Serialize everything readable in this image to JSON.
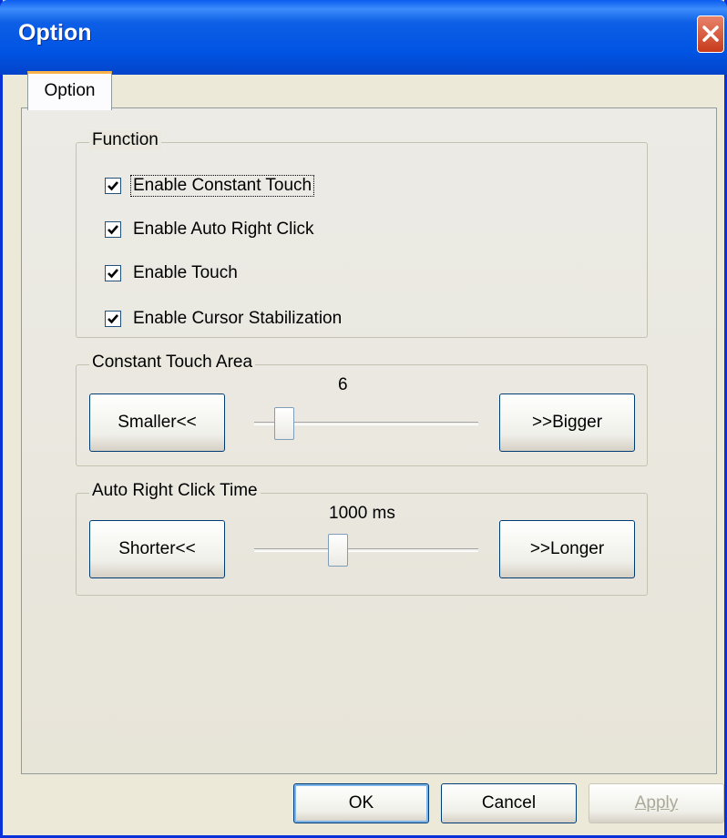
{
  "window": {
    "title": "Option"
  },
  "tabs": [
    {
      "label": "Option"
    }
  ],
  "function_group": {
    "legend": "Function",
    "checkboxes": [
      {
        "label": "Enable Constant Touch",
        "checked": true
      },
      {
        "label": "Enable Auto Right Click",
        "checked": true
      },
      {
        "label": "Enable Touch",
        "checked": true
      },
      {
        "label": "Enable Cursor Stabilization",
        "checked": true
      }
    ]
  },
  "touch_area_group": {
    "legend": "Constant Touch Area",
    "value": "6",
    "decrease_label": "Smaller<<",
    "increase_label": ">>Bigger",
    "slider_fraction": 0.1
  },
  "right_click_group": {
    "legend": "Auto Right Click Time",
    "value": "1000 ms",
    "decrease_label": "Shorter<<",
    "increase_label": ">>Longer",
    "slider_fraction": 0.36
  },
  "footer": {
    "ok": "OK",
    "cancel": "Cancel",
    "apply": "Apply"
  },
  "colors": {
    "title_bar": "#0054e3",
    "close_button": "#c73b1b",
    "face": "#ece9d8"
  }
}
